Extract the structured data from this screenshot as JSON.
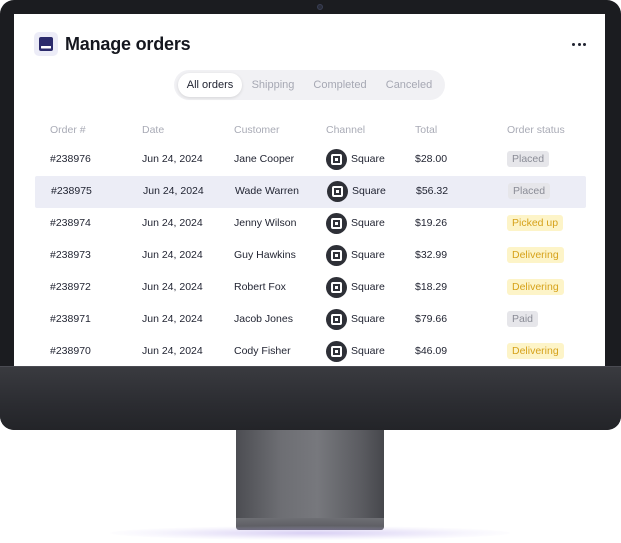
{
  "header": {
    "title": "Manage orders",
    "more_label": "More options"
  },
  "tabs": [
    {
      "label": "All orders",
      "active": true
    },
    {
      "label": "Shipping",
      "active": false
    },
    {
      "label": "Completed",
      "active": false
    },
    {
      "label": "Canceled",
      "active": false
    }
  ],
  "table": {
    "columns": [
      "Order #",
      "Date",
      "Customer",
      "Channel",
      "Total",
      "Order status"
    ],
    "rows": [
      {
        "order": "#238976",
        "date": "Jun 24, 2024",
        "customer": "Jane Cooper",
        "channel": "Square",
        "total": "$28.00",
        "status": "Placed",
        "status_tone": "gray"
      },
      {
        "order": "#238975",
        "date": "Jun 24, 2024",
        "customer": "Wade Warren",
        "channel": "Square",
        "total": "$56.32",
        "status": "Placed",
        "status_tone": "gray",
        "highlighted": true
      },
      {
        "order": "#238974",
        "date": "Jun 24, 2024",
        "customer": "Jenny Wilson",
        "channel": "Square",
        "total": "$19.26",
        "status": "Picked up",
        "status_tone": "yellow"
      },
      {
        "order": "#238973",
        "date": "Jun 24, 2024",
        "customer": "Guy Hawkins",
        "channel": "Square",
        "total": "$32.99",
        "status": "Delivering",
        "status_tone": "yellow"
      },
      {
        "order": "#238972",
        "date": "Jun 24, 2024",
        "customer": "Robert Fox",
        "channel": "Square",
        "total": "$18.29",
        "status": "Delivering",
        "status_tone": "yellow"
      },
      {
        "order": "#238971",
        "date": "Jun 24, 2024",
        "customer": "Jacob Jones",
        "channel": "Square",
        "total": "$79.66",
        "status": "Paid",
        "status_tone": "gray"
      },
      {
        "order": "#238970",
        "date": "Jun 24, 2024",
        "customer": "Cody Fisher",
        "channel": "Square",
        "total": "$46.09",
        "status": "Delivering",
        "status_tone": "yellow"
      }
    ]
  },
  "icons": {
    "app": "inbox-tray-icon",
    "channel": "square-pos-icon",
    "more": "ellipsis-icon"
  },
  "colors": {
    "accent": "#2b2a6b",
    "highlight_row": "#ecedf6",
    "status_yellow_bg": "#fdf4c8",
    "status_yellow_text": "#d6a21b",
    "status_gray_bg": "#e6e6ea",
    "status_gray_text": "#8a8c96"
  }
}
